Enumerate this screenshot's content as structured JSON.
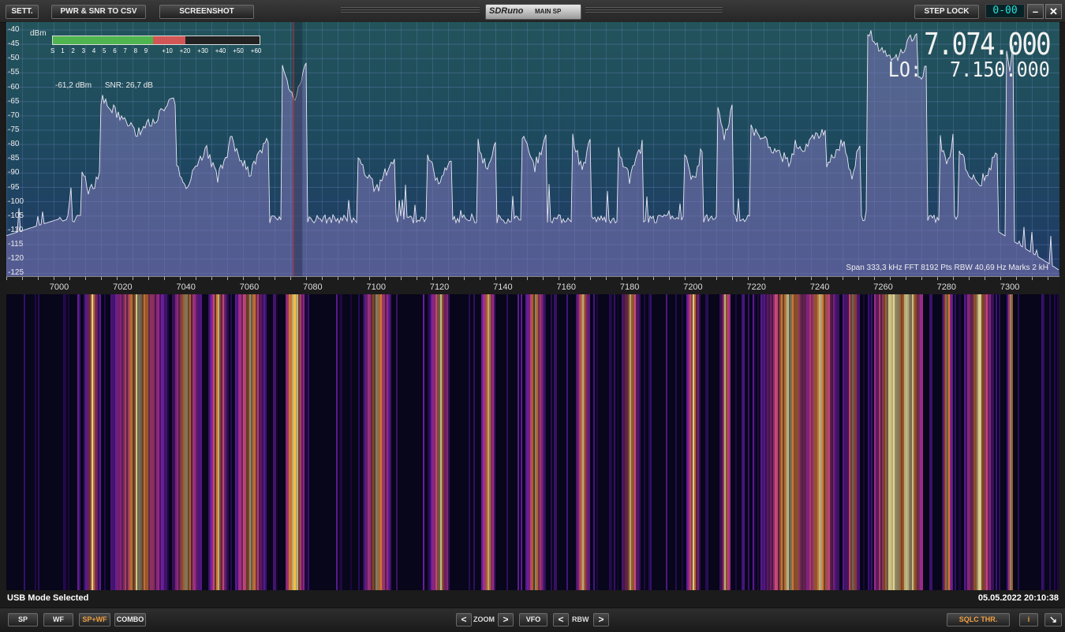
{
  "toolbar": {
    "sett": "SETT.",
    "pwr_csv": "PWR & SNR TO CSV",
    "screenshot": "SCREENSHOT",
    "app_name": "SDRuno",
    "panel_name": "MAIN SP",
    "step_lock": "STEP LOCK",
    "digits": "0-00",
    "minimize": "–",
    "close": "✕"
  },
  "spectrum": {
    "unit": "dBm",
    "y_ticks": [
      "-40",
      "-45",
      "-50",
      "-55",
      "-60",
      "-65",
      "-70",
      "-75",
      "-80",
      "-85",
      "-90",
      "-95",
      "-100",
      "-105",
      "-110",
      "-115",
      "-120",
      "-125"
    ],
    "s_scale": [
      "S",
      "1",
      "2",
      "3",
      "4",
      "5",
      "6",
      "7",
      "8",
      "9",
      "+10",
      "+20",
      "+30",
      "+40",
      "+50",
      "+60"
    ],
    "signal_level": "-61,2 dBm",
    "snr": "SNR: 26,7 dB",
    "vfo_freq": "7.074.000",
    "lo_label": "LO:",
    "lo_freq": "7.150.000",
    "span_info": "Span 333,3 kHz   FFT 8192 Pts   RBW 40,69 Hz   Marks 2 kH",
    "meter_fraction_green": 0.485,
    "meter_fraction_red": 0.155,
    "cursor_khz": 7074
  },
  "x_axis": {
    "ticks": [
      "7000",
      "7020",
      "7040",
      "7060",
      "7080",
      "7100",
      "7120",
      "7140",
      "7160",
      "7180",
      "7200",
      "7220",
      "7240",
      "7260",
      "7280",
      "7300"
    ],
    "tick_khz": [
      7000,
      7020,
      7040,
      7060,
      7080,
      7100,
      7120,
      7140,
      7160,
      7180,
      7200,
      7220,
      7240,
      7260,
      7280,
      7300
    ]
  },
  "status": {
    "mode": "USB Mode Selected",
    "timestamp": "05.05.2022 20:10:38"
  },
  "bottom": {
    "sp": "SP",
    "wf": "WF",
    "spwf": "SP+WF",
    "combo": "COMBO",
    "left_arrow": "<",
    "right_arrow": ">",
    "zoom": "ZOOM",
    "vfo": "VFO",
    "rbw": "RBW",
    "sqlc": "SQLC THR.",
    "info": "i",
    "resize": "↘"
  },
  "colors": {
    "trace": "#e8e8f2",
    "fill": "#7d76b6",
    "cursor": "#c0302a",
    "meter_green": "#4fb54f",
    "meter_red": "#d25656"
  }
}
